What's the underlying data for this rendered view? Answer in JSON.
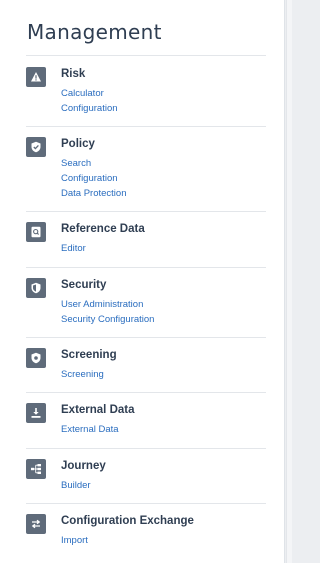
{
  "title": "Management",
  "sections": [
    {
      "title": "Risk",
      "icon": "warning-icon",
      "links": [
        "Calculator",
        "Configuration"
      ]
    },
    {
      "title": "Policy",
      "icon": "shield-check-icon",
      "links": [
        "Search",
        "Configuration",
        "Data Protection"
      ]
    },
    {
      "title": "Reference Data",
      "icon": "document-search-icon",
      "links": [
        "Editor"
      ]
    },
    {
      "title": "Security",
      "icon": "security-shield-icon",
      "links": [
        "User Administration",
        "Security Configuration"
      ]
    },
    {
      "title": "Screening",
      "icon": "screening-shield-icon",
      "links": [
        "Screening"
      ]
    },
    {
      "title": "External Data",
      "icon": "download-icon",
      "links": [
        "External Data"
      ]
    },
    {
      "title": "Journey",
      "icon": "journey-flow-icon",
      "links": [
        "Builder"
      ]
    },
    {
      "title": "Configuration Exchange",
      "icon": "exchange-arrows-icon",
      "links": [
        "Import"
      ]
    }
  ],
  "colors": {
    "link": "#2a6dbf",
    "heading": "#2f3e52",
    "icon_bg": "#5f6b7a"
  }
}
